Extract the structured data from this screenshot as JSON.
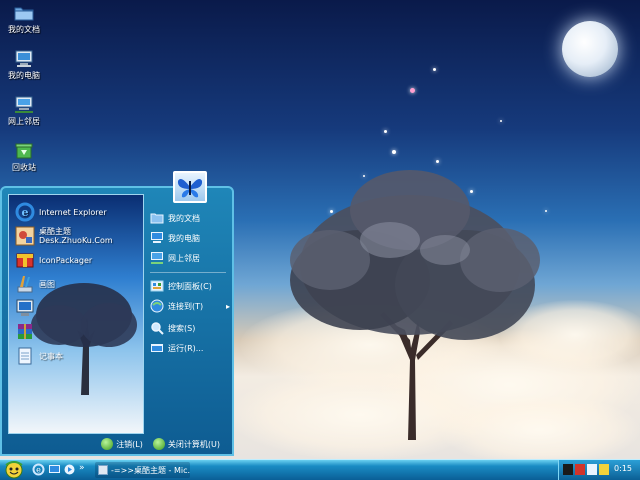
{
  "desktop": {
    "icons": [
      {
        "label": "我的文档",
        "icon": "folder-icon"
      },
      {
        "label": "我的电脑",
        "icon": "computer-icon"
      },
      {
        "label": "网上邻居",
        "icon": "network-icon"
      },
      {
        "label": "回收站",
        "icon": "recycle-bin-icon"
      }
    ]
  },
  "start_menu": {
    "pinned": [
      {
        "label": "Internet Explorer",
        "icon": "ie-icon"
      },
      {
        "label": "桌酷主题",
        "sub": "Desk.ZhuoKu.Com",
        "icon": "zhuoku-icon"
      },
      {
        "label": "IconPackager",
        "icon": "iconpackager-icon"
      },
      {
        "label": "画图",
        "icon": "paint-icon"
      },
      {
        "label": "",
        "icon": "monitor-app-icon"
      },
      {
        "label": "",
        "icon": "winrar-icon"
      },
      {
        "label": "记事本",
        "icon": "notepad-icon"
      }
    ],
    "right": [
      {
        "label": "我的文档",
        "icon": "folder-icon"
      },
      {
        "label": "我的电脑",
        "icon": "computer-icon"
      },
      {
        "label": "网上邻居",
        "icon": "network-icon"
      },
      {
        "label": "控制面板(C)",
        "icon": "control-panel-icon"
      },
      {
        "label": "连接到(T)",
        "icon": "connect-icon"
      },
      {
        "label": "搜索(S)",
        "icon": "search-icon"
      },
      {
        "label": "运行(R)...",
        "icon": "run-icon"
      }
    ],
    "logoff_label": "注销(L)",
    "shutdown_label": "关闭计算机(U)"
  },
  "taskbar": {
    "task_label": "-=>>桌酷主题 - Mic...",
    "clock": "0:15"
  },
  "colors": {
    "taskbar": "#0a5e96",
    "start_menu": "#0e5c92",
    "accent": "#5fc0e6"
  }
}
